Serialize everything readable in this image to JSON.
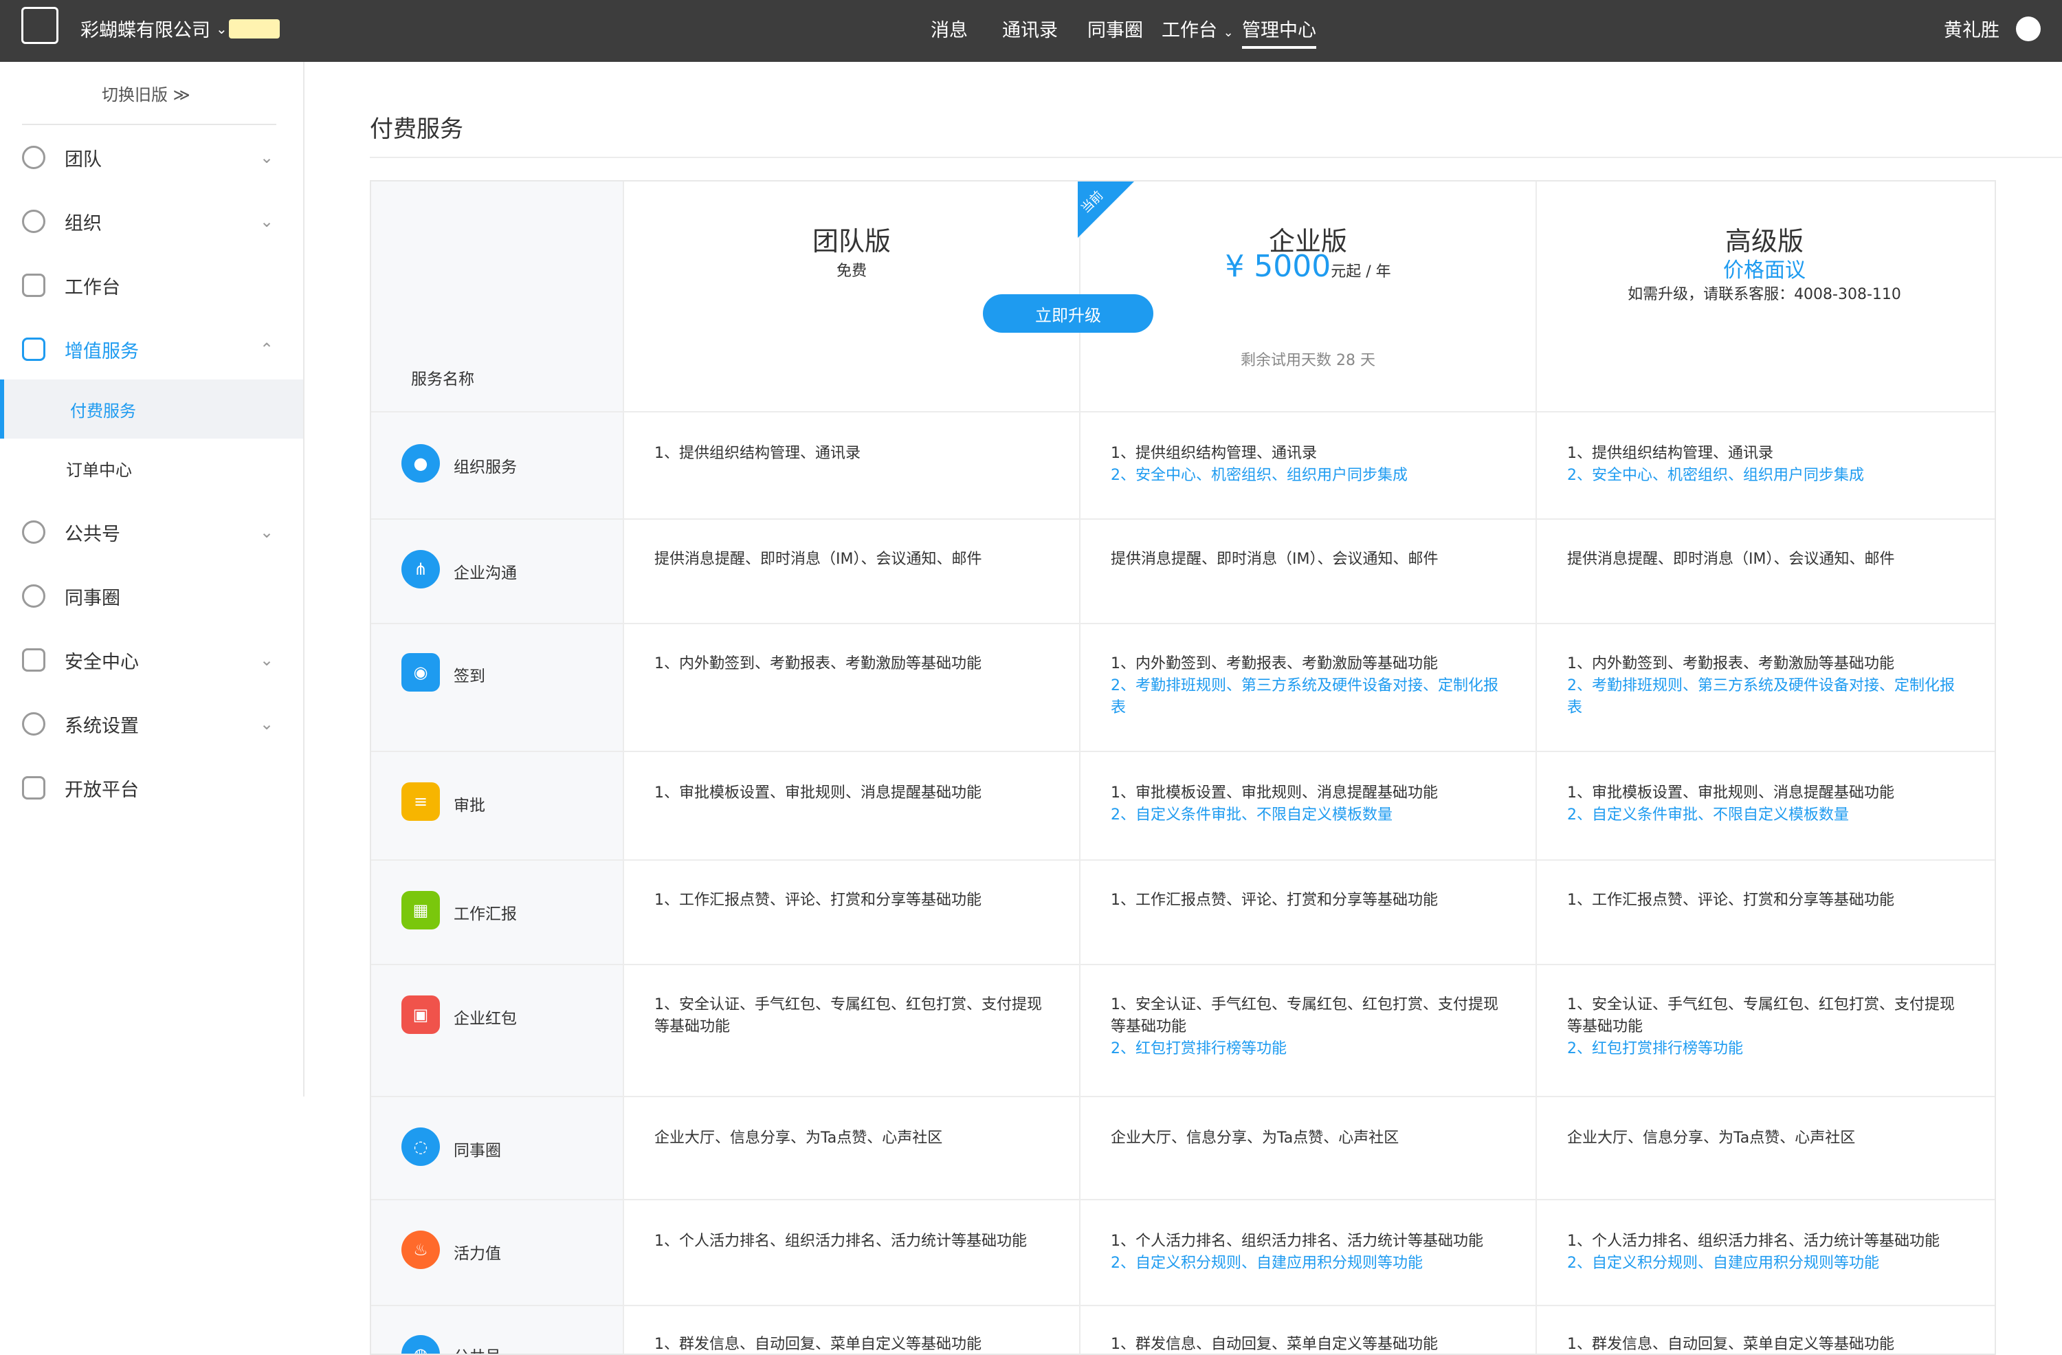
{
  "topbar": {
    "company": "彩蝴蝶有限公司",
    "nav": [
      "消息",
      "通讯录",
      "同事圈",
      "工作台",
      "管理中心"
    ],
    "user": "黄礼胜"
  },
  "sidebar": {
    "switch_old": "切换旧版 ≫",
    "items": [
      {
        "label": "团队"
      },
      {
        "label": "组织"
      },
      {
        "label": "工作台"
      },
      {
        "label": "增值服务"
      },
      {
        "label": "付费服务"
      },
      {
        "label": "订单中心"
      },
      {
        "label": "公共号"
      },
      {
        "label": "同事圈"
      },
      {
        "label": "安全中心"
      },
      {
        "label": "系统设置"
      },
      {
        "label": "开放平台"
      }
    ]
  },
  "page": {
    "title": "付费服务"
  },
  "plans": {
    "service_header": "服务名称",
    "team": {
      "name": "团队版",
      "sub": "免费"
    },
    "enterprise": {
      "ribbon": "当前",
      "name": "企业版",
      "price": "¥ 5000",
      "price_unit": "元起 / 年",
      "button": "立即升级",
      "trial": "剩余试用天数 28 天"
    },
    "premium": {
      "name": "高级版",
      "price": "价格面议",
      "contact": "如需升级，请联系客服：4008-308-110"
    }
  },
  "rows": [
    {
      "name": "组织服务",
      "team": "1、提供组织结构管理、通讯录",
      "ent1": "1、提供组织结构管理、通讯录",
      "ent2": "2、安全中心、机密组织、组织用户同步集成",
      "pre1": "1、提供组织结构管理、通讯录",
      "pre2": "2、安全中心、机密组织、组织用户同步集成"
    },
    {
      "name": "企业沟通",
      "team": "提供消息提醒、即时消息（IM）、会议通知、邮件",
      "ent1": "提供消息提醒、即时消息（IM）、会议通知、邮件",
      "ent2": "",
      "pre1": "提供消息提醒、即时消息（IM）、会议通知、邮件",
      "pre2": ""
    },
    {
      "name": "签到",
      "team": "1、内外勤签到、考勤报表、考勤激励等基础功能",
      "ent1": "1、内外勤签到、考勤报表、考勤激励等基础功能",
      "ent2": "2、考勤排班规则、第三方系统及硬件设备对接、定制化报表",
      "pre1": "1、内外勤签到、考勤报表、考勤激励等基础功能",
      "pre2": "2、考勤排班规则、第三方系统及硬件设备对接、定制化报表"
    },
    {
      "name": "审批",
      "team": "1、审批模板设置、审批规则、消息提醒基础功能",
      "ent1": "1、审批模板设置、审批规则、消息提醒基础功能",
      "ent2": "2、自定义条件审批、不限自定义模板数量",
      "pre1": "1、审批模板设置、审批规则、消息提醒基础功能",
      "pre2": "2、自定义条件审批、不限自定义模板数量"
    },
    {
      "name": "工作汇报",
      "team": "1、工作汇报点赞、评论、打赏和分享等基础功能",
      "ent1": "1、工作汇报点赞、评论、打赏和分享等基础功能",
      "ent2": "",
      "pre1": "1、工作汇报点赞、评论、打赏和分享等基础功能",
      "pre2": ""
    },
    {
      "name": "企业红包",
      "team": "1、安全认证、手气红包、专属红包、红包打赏、支付提现等基础功能",
      "ent1": "1、安全认证、手气红包、专属红包、红包打赏、支付提现等基础功能",
      "ent2": "2、红包打赏排行榜等功能",
      "pre1": "1、安全认证、手气红包、专属红包、红包打赏、支付提现等基础功能",
      "pre2": "2、红包打赏排行榜等功能"
    },
    {
      "name": "同事圈",
      "team": "企业大厅、信息分享、为Ta点赞、心声社区",
      "ent1": "企业大厅、信息分享、为Ta点赞、心声社区",
      "ent2": "",
      "pre1": "企业大厅、信息分享、为Ta点赞、心声社区",
      "pre2": ""
    },
    {
      "name": "活力值",
      "team": "1、个人活力排名、组织活力排名、活力统计等基础功能",
      "ent1": "1、个人活力排名、组织活力排名、活力统计等基础功能",
      "ent2": "2、自定义积分规则、自建应用积分规则等功能",
      "pre1": "1、个人活力排名、组织活力排名、活力统计等基础功能",
      "pre2": "2、自定义积分规则、自建应用积分规则等功能"
    },
    {
      "name": "公共号",
      "team": "1、群发信息、自动回复、菜单自定义等基础功能",
      "ent1": "1、群发信息、自动回复、菜单自定义等基础功能",
      "ent2": "",
      "pre1": "1、群发信息、自动回复、菜单自定义等基础功能",
      "pre2": ""
    }
  ],
  "colors": {
    "accent": "#1e9bf0",
    "topbar": "#3d3d3d",
    "icon_blue": "#1e9bf0",
    "icon_yellow": "#f7b500",
    "icon_green": "#7ac70c",
    "icon_red": "#f0534b",
    "icon_orange": "#ff6a2b"
  }
}
